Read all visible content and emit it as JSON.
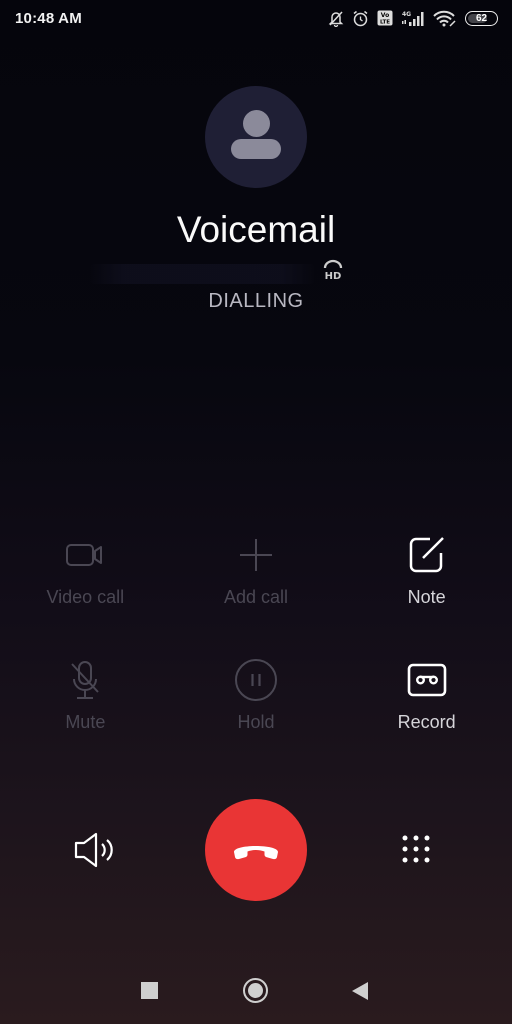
{
  "status_bar": {
    "time": "10:48 AM",
    "icons": [
      "notifications-off-icon",
      "alarm-icon",
      "volte-icon",
      "signal-4g-icon",
      "wifi-icon",
      "battery-icon"
    ],
    "network_label": "4G",
    "volte_label_top": "Vo",
    "volte_label_bottom": "LTE",
    "battery_level": "62"
  },
  "call": {
    "contact_name": "Voicemail",
    "number_redacted": "",
    "hd_label": "HD",
    "status": "DIALLING"
  },
  "actions": {
    "row1": [
      {
        "id": "video-call",
        "label": "Video call",
        "icon": "video-camera-icon",
        "enabled": false
      },
      {
        "id": "add-call",
        "label": "Add call",
        "icon": "plus-icon",
        "enabled": false
      },
      {
        "id": "note",
        "label": "Note",
        "icon": "note-edit-icon",
        "enabled": true
      }
    ],
    "row2": [
      {
        "id": "mute",
        "label": "Mute",
        "icon": "microphone-off-icon",
        "enabled": false
      },
      {
        "id": "hold",
        "label": "Hold",
        "icon": "pause-circle-icon",
        "enabled": false
      },
      {
        "id": "record",
        "label": "Record",
        "icon": "voicemail-tape-icon",
        "enabled": true
      }
    ]
  },
  "controls": {
    "speaker": "speaker-icon",
    "end_call": "end-call-icon",
    "end_call_color": "#e93535",
    "dialpad": "dialpad-icon"
  },
  "nav_bar": {
    "recents": "recents-square-icon",
    "home": "home-circle-icon",
    "back": "back-triangle-icon"
  }
}
